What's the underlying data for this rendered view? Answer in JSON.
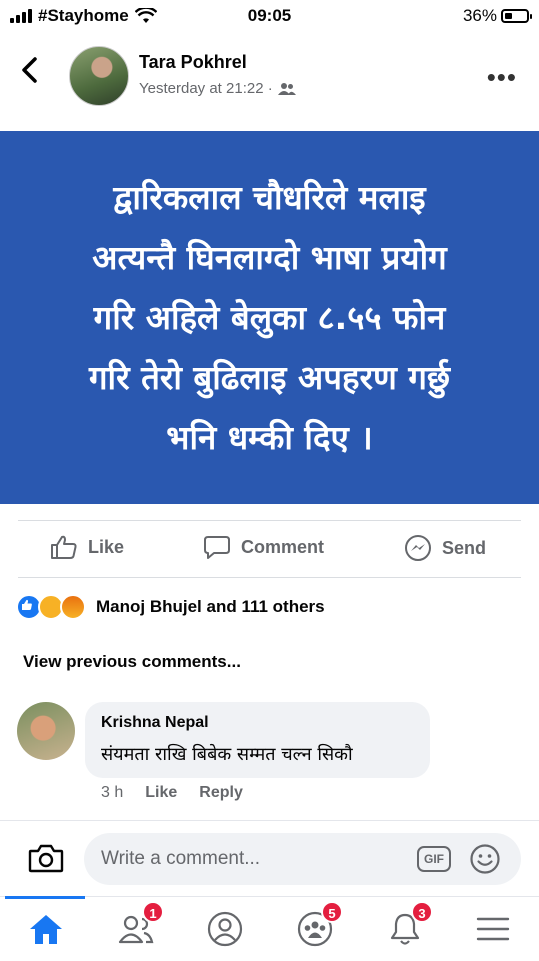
{
  "status": {
    "carrier": "#Stayhome",
    "time": "09:05",
    "battery": "36%",
    "battery_level": 0.36
  },
  "post": {
    "author": "Tara Pokhrel",
    "timestamp": "Yesterday at 21:22 ·",
    "audience_icon": "friends-icon",
    "text_lines": [
      "द्वारिकलाल चौधरिले मलाइ",
      "अत्यन्तै घिनलाग्दो भाषा प्रयोग",
      "गरि अहिले बेलुका ८.५५ फोन",
      "गरि तेरो बुढिलाइ अपहरण गर्छु",
      "भनि धम्की दिए ।"
    ],
    "card_color": "#2a58b0"
  },
  "actions": {
    "like": "Like",
    "comment": "Comment",
    "send": "Send"
  },
  "reactions": {
    "summary": "Manoj Bhujel and 111 others"
  },
  "comments": {
    "view_previous": "View previous comments...",
    "items": [
      {
        "author": "Krishna Nepal",
        "text": "संयमता राखि बिबेक सम्मत चल्न सिकौ",
        "age": "3 h",
        "like": "Like",
        "reply": "Reply"
      }
    ]
  },
  "composer": {
    "placeholder": "Write a comment...",
    "gif": "GIF"
  },
  "tabbar": {
    "friends_badge": "1",
    "groups_badge": "5",
    "notifications_badge": "3",
    "accent": "#1877f2"
  }
}
